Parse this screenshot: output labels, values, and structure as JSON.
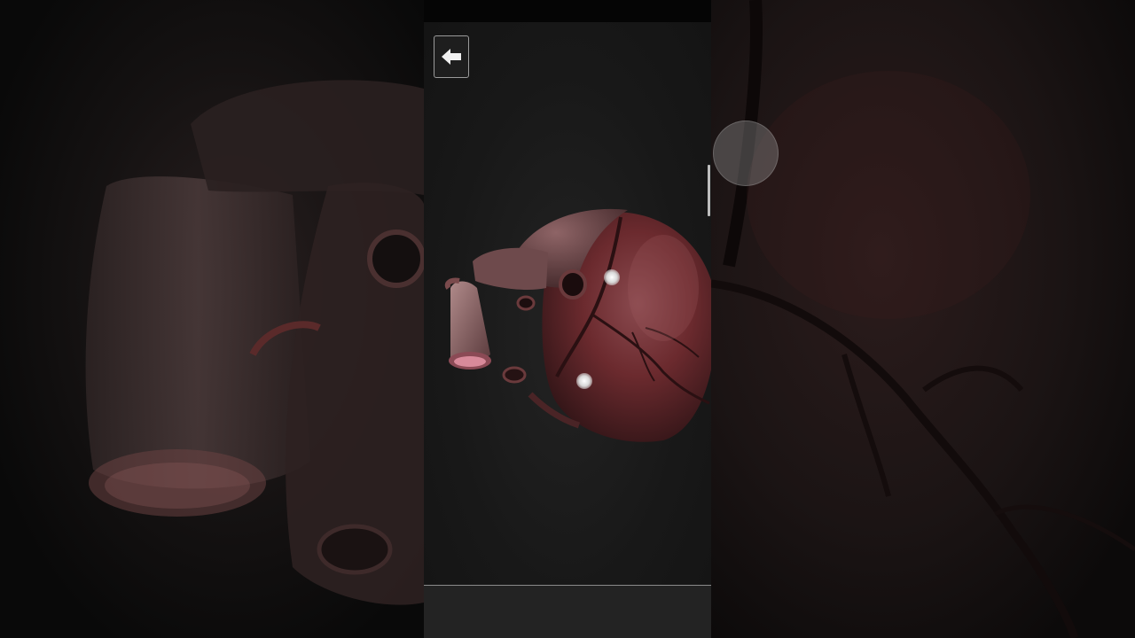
{
  "app": {
    "type": "3d-anatomy-viewer"
  },
  "toolbar": {
    "back_icon": "arrow-left-icon"
  },
  "viewer": {
    "model": "heart-3d-model",
    "hotspot_count": 2
  },
  "colors": {
    "background": "#161616",
    "status_strip": "#050505",
    "bottom_bar": "#232323",
    "button_border": "#9a9a9a",
    "model_tint": "#6b2a2e"
  }
}
